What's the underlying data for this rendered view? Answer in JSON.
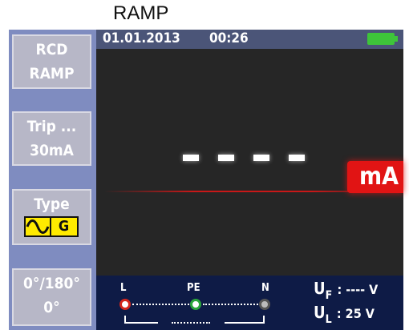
{
  "caption": "RAMP",
  "sidebar": {
    "mode": {
      "line1": "RCD",
      "line2": "RAMP"
    },
    "trip": {
      "line1": "Trip ...",
      "line2": "30mA"
    },
    "type": {
      "label": "Type",
      "wave_icon": "ac-sine-wave-icon",
      "letter": "G"
    },
    "phase": {
      "line1": "0°/180°",
      "line2": "0°"
    }
  },
  "topbar": {
    "date": "01.01.2013",
    "time": "00:26",
    "battery_icon": "battery-full-icon"
  },
  "display": {
    "value": "- - - -",
    "unit": "mA"
  },
  "bottombar": {
    "terminals": [
      {
        "label": "L"
      },
      {
        "label": "PE"
      },
      {
        "label": "N"
      }
    ],
    "uf": {
      "symbol": "U",
      "sub": "F",
      "value": ": ---- V"
    },
    "ul": {
      "symbol": "U",
      "sub": "L",
      "value": ": 25 V"
    }
  },
  "colors": {
    "sidebar": "#7f8cc0",
    "topbar": "#4b5578",
    "display_bg": "#262626",
    "unit_badge": "#e11414",
    "bottombar": "#0e1b46",
    "type_highlight": "#ffea00",
    "battery": "#3ec43a",
    "terminal_L": "#d4261c",
    "terminal_PE": "#2aa63a",
    "terminal_N": "#555555"
  }
}
